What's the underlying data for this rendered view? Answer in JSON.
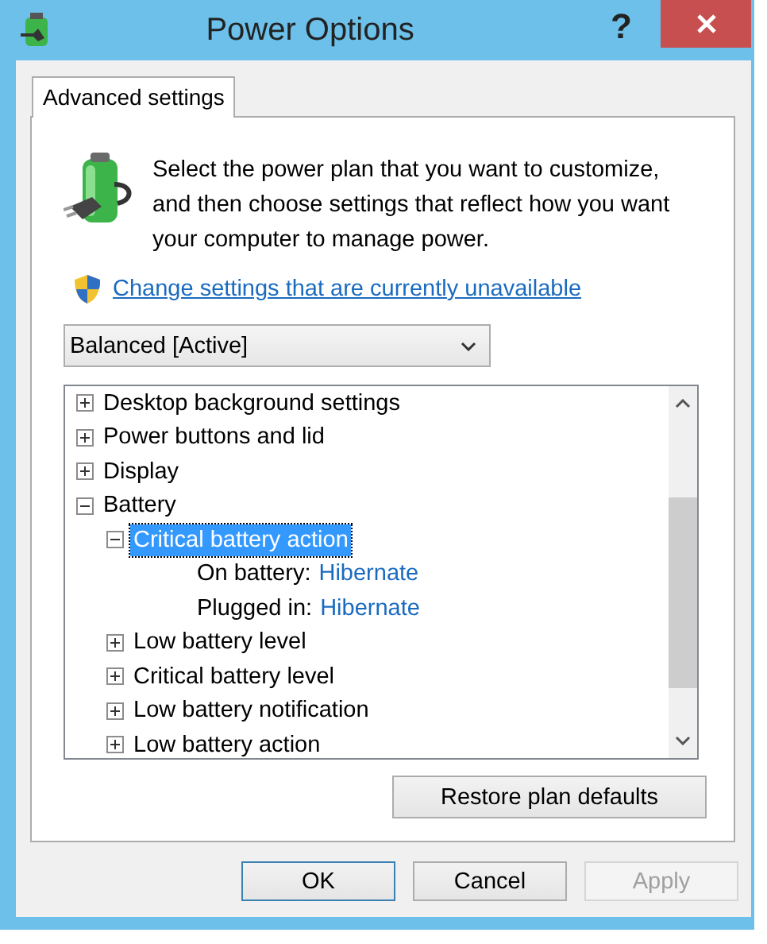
{
  "window": {
    "title": "Power Options",
    "help": "?"
  },
  "tabs": [
    {
      "label": "Advanced settings",
      "selected": true
    }
  ],
  "description": "Select the power plan that you want to customize, and then choose settings that reflect how you want your computer to manage power.",
  "link": "Change settings that are currently unavailable",
  "plan_dropdown": {
    "value": "Balanced [Active]"
  },
  "tree": {
    "items": [
      {
        "label": "Desktop background settings",
        "expanded": false,
        "selected": false
      },
      {
        "label": "Power buttons and lid",
        "expanded": false,
        "selected": false
      },
      {
        "label": "Display",
        "expanded": false,
        "selected": false
      },
      {
        "label": "Battery",
        "expanded": true,
        "selected": false,
        "children": [
          {
            "label": "Critical battery action",
            "expanded": true,
            "selected": true,
            "children": [
              {
                "kind": "setting",
                "label": "On battery:",
                "value": "Hibernate"
              },
              {
                "kind": "setting",
                "label": "Plugged in:",
                "value": "Hibernate"
              }
            ]
          },
          {
            "label": "Low battery level",
            "expanded": false,
            "selected": false
          },
          {
            "label": "Critical battery level",
            "expanded": false,
            "selected": false
          },
          {
            "label": "Low battery notification",
            "expanded": false,
            "selected": false
          },
          {
            "label": "Low battery action",
            "expanded": false,
            "selected": false
          }
        ]
      }
    ]
  },
  "restore_button": "Restore plan defaults",
  "buttons": [
    {
      "label": "OK",
      "disabled": false,
      "default": true
    },
    {
      "label": "Cancel",
      "disabled": false,
      "default": false
    },
    {
      "label": "Apply",
      "disabled": true,
      "default": false
    }
  ]
}
